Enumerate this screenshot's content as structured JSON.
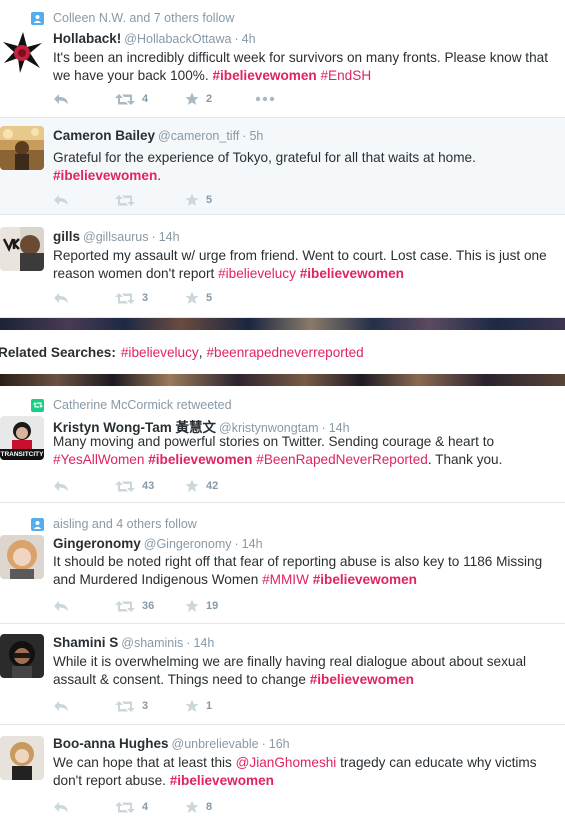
{
  "tweets": [
    {
      "context": "Colleen N.W. and 7 others follow",
      "context_type": "follow",
      "name": "Hollaback!",
      "handle": "@HollabackOttawa",
      "time": "4h",
      "text_parts": [
        "It's been an incredibly difficult week for survivors on many fronts. Please know that we have your back 100%. ",
        "#ibelievewomen",
        " ",
        "#EndSH"
      ],
      "retweets": "4",
      "favorites": "2"
    },
    {
      "name": "Cameron Bailey",
      "handle": "@cameron_tiff",
      "time": "5h",
      "text_parts": [
        "Grateful for the experience of Tokyo, grateful for all that waits at home. ",
        "#ibelievewomen",
        "."
      ],
      "retweets": "",
      "favorites": "5"
    },
    {
      "name": "gills",
      "handle": "@gillsaurus",
      "time": "14h",
      "text_parts": [
        "Reported my assault w/ urge from friend. Went to court. Lost case. This is just one reason women don't report ",
        "#ibelievelucy",
        " ",
        "#ibelievewomen"
      ],
      "retweets": "3",
      "favorites": "5"
    },
    {
      "context": "Catherine McCormick retweeted",
      "context_type": "retweet",
      "name": "Kristyn Wong-Tam 黃慧文",
      "handle": "@kristynwongtam",
      "time": "14h",
      "text_parts": [
        "Many moving and powerful stories on Twitter. Sending courage & heart to ",
        "#YesAllWomen",
        " ",
        "#ibelievewomen",
        " ",
        "#BeenRapedNeverReported",
        ". Thank you."
      ],
      "retweets": "43",
      "favorites": "42"
    },
    {
      "context": "aisling and 4 others follow",
      "context_type": "follow",
      "name": "Gingeronomy",
      "handle": "@Gingeronomy",
      "time": "14h",
      "text_parts": [
        "It should be noted right off that fear of reporting abuse is also key to 1186 Missing and Murdered Indigenous Women ",
        "#MMIW",
        " ",
        "#ibelievewomen"
      ],
      "retweets": "36",
      "favorites": "19"
    },
    {
      "name": "Shamini S",
      "handle": "@shaminis",
      "time": "14h",
      "text_parts": [
        "While it is overwhelming we are finally having real dialogue about about sexual assault & consent. Things need to change ",
        "#ibelievewomen"
      ],
      "retweets": "3",
      "favorites": "1"
    },
    {
      "name": "Boo-anna Hughes",
      "handle": "@unbrelievable",
      "time": "16h",
      "text_parts": [
        "We can hope that at least this ",
        "@JianGhomeshi",
        " tragedy can educate why victims don't report abuse. ",
        "#ibelievewomen"
      ],
      "retweets": "4",
      "favorites": "8"
    }
  ],
  "related": {
    "label": "Related Searches:",
    "links": [
      "#ibelievelucy",
      "#beenrapedneverreported"
    ],
    "separator": ","
  },
  "avatar_text": {
    "kristyn_badge": "TRANSITCITY"
  },
  "colors": {
    "hashtag": "#e0245e",
    "meta": "#8899a6",
    "text": "#292f33",
    "follow_icon": "#55acee",
    "retweet_icon": "#19cf86"
  }
}
